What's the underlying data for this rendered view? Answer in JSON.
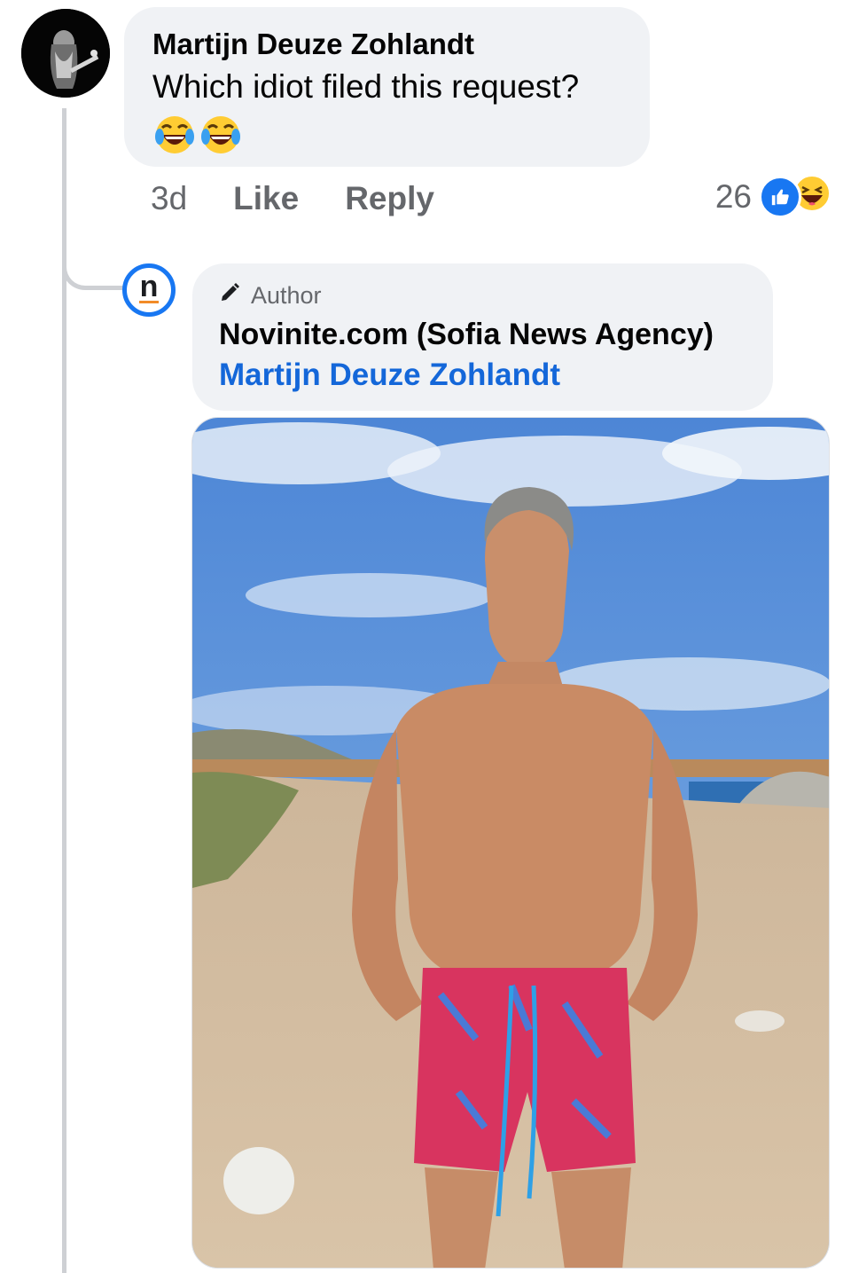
{
  "comment": {
    "author": "Martijn Deuze Zohlandt",
    "text": "Which idiot filed this request?",
    "emojis": [
      "laughing-tears-icon",
      "laughing-tears-icon"
    ],
    "time": "3d",
    "like_label": "Like",
    "reply_label": "Reply",
    "reaction_count": "26",
    "reaction_icons": [
      "like-reaction-icon",
      "haha-reaction-icon"
    ]
  },
  "reply": {
    "badge_label": "Author",
    "badge_icon": "pencil-icon",
    "page_name": "Novinite.com (Sofia News Agency)",
    "mention": "Martijn Deuze Zohlandt",
    "avatar_letter": "n",
    "photo": "photo-shirtless-man-on-beach"
  },
  "colors": {
    "bubble": "#f0f2f5",
    "link": "#1467d9",
    "meta": "#65676b",
    "like_blue": "#1877f2",
    "thread_line": "#ced0d4"
  }
}
